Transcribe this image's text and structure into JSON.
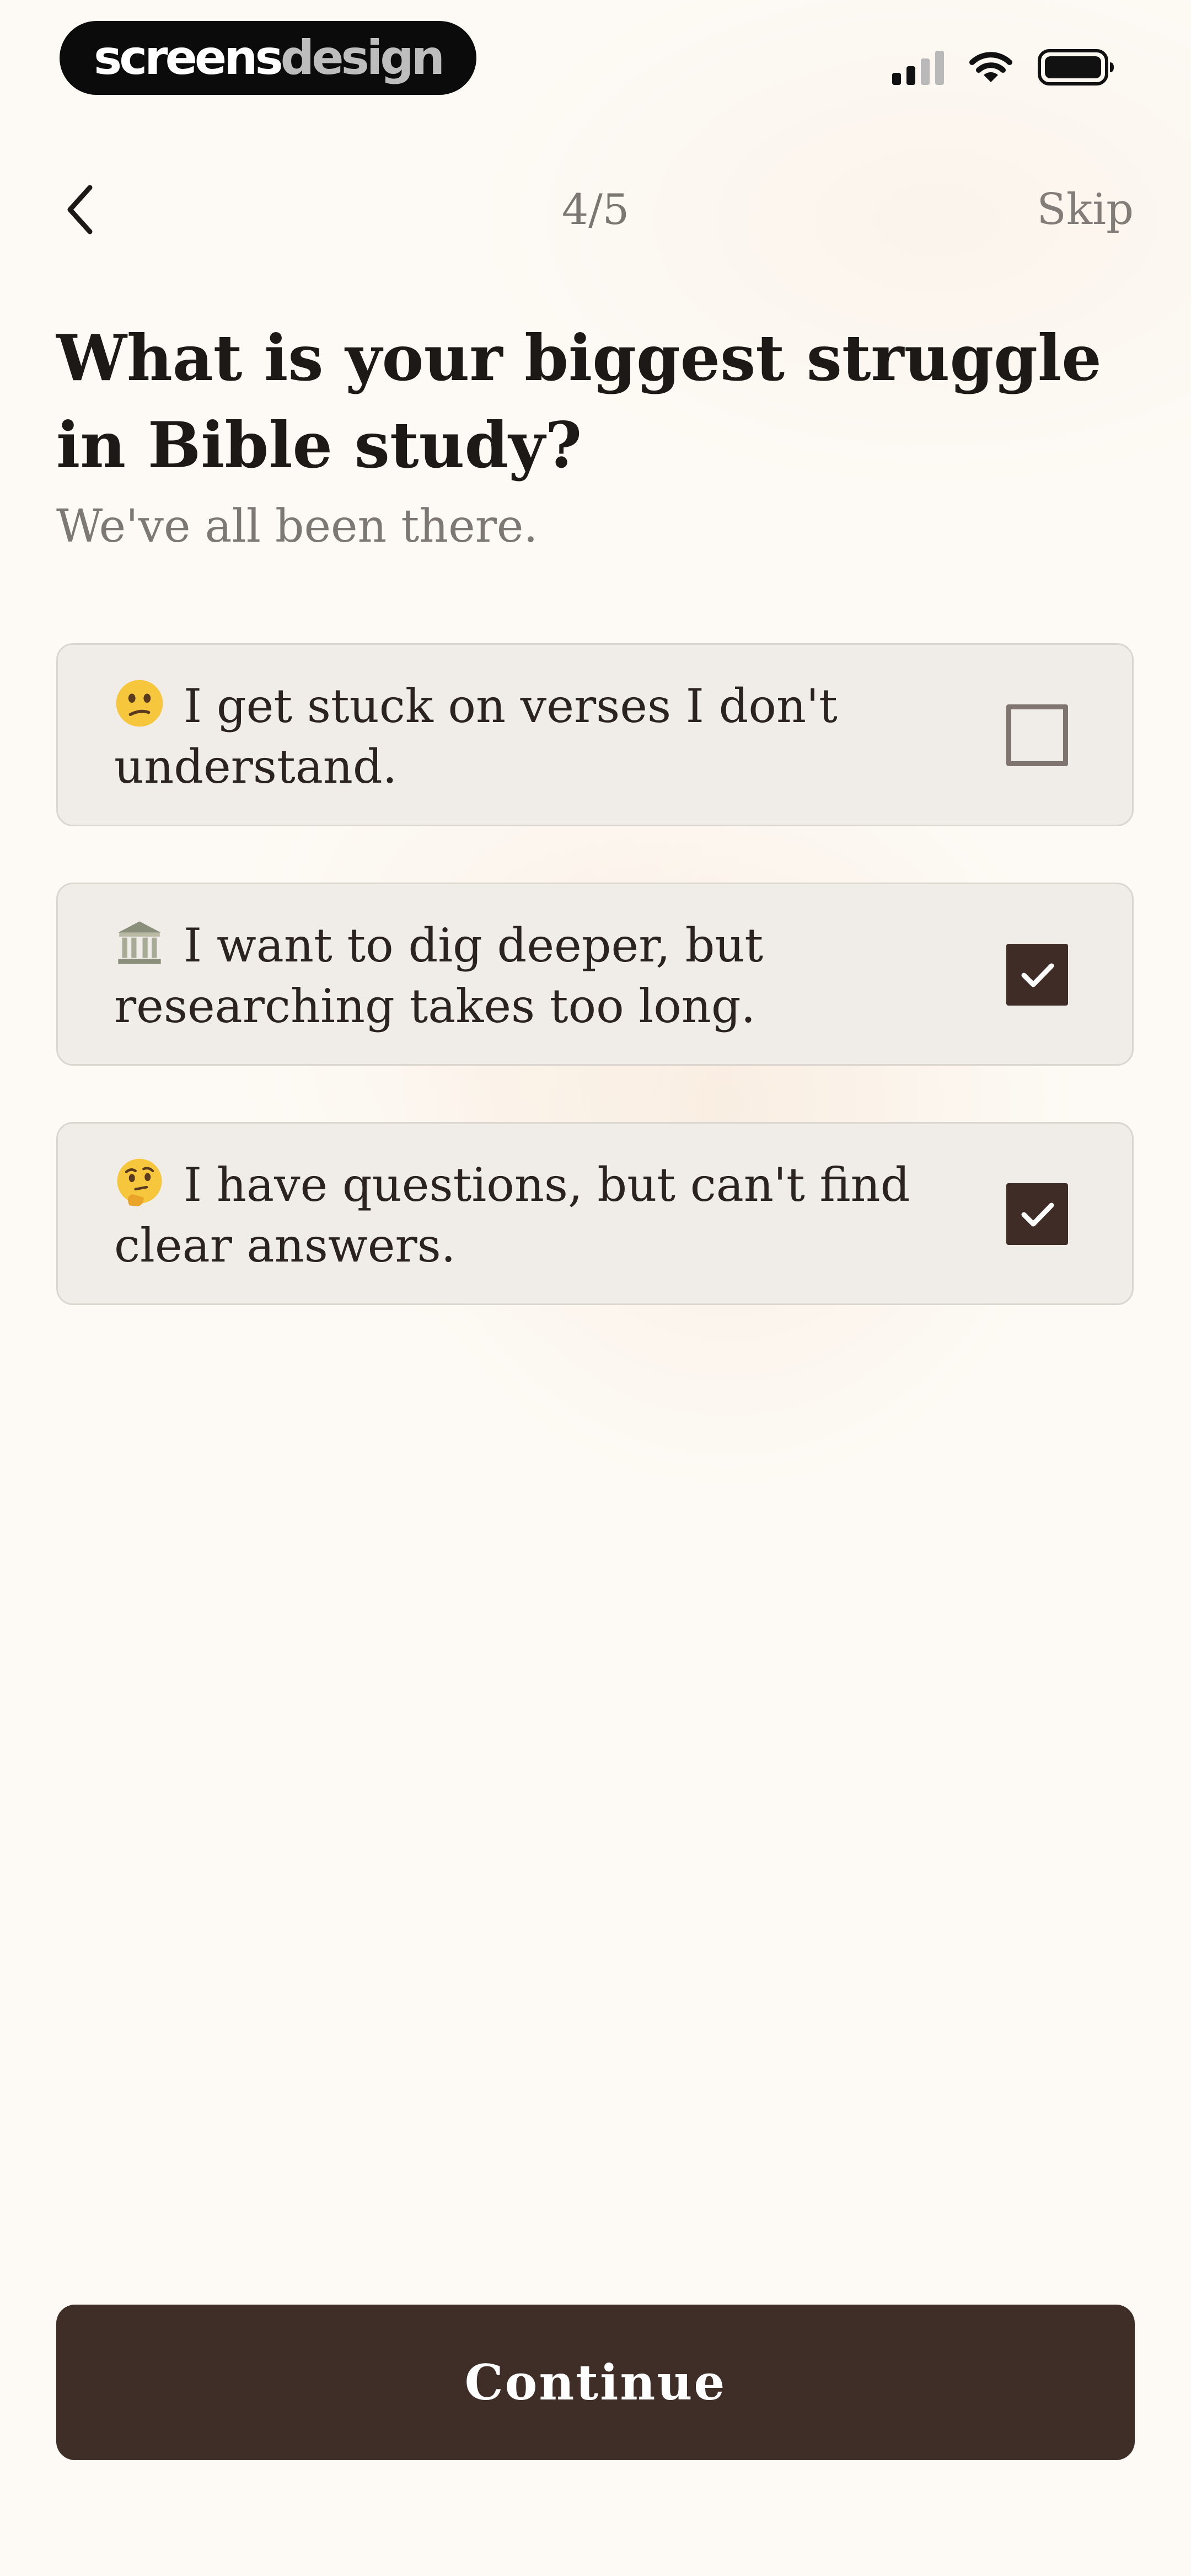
{
  "status_bar": {
    "logo_part1": "screens",
    "logo_part2": "design"
  },
  "nav": {
    "back_icon": "chevron-left-icon",
    "progress": "4/5",
    "skip_label": "Skip"
  },
  "question": {
    "title": "What is your biggest struggle in Bible study?",
    "subtitle": "We've all been there."
  },
  "options": [
    {
      "emoji": "confused-face-icon",
      "text": "I get stuck on verses I don't understand.",
      "checked": false
    },
    {
      "emoji": "classical-building-icon",
      "text": "I want to dig deeper, but researching takes too long.",
      "checked": true
    },
    {
      "emoji": "thinking-face-icon",
      "text": "I have questions, but can't find clear answers.",
      "checked": true
    }
  ],
  "continue_label": "Continue",
  "colors": {
    "background": "#fdfaf5",
    "card": "#f0ece8",
    "accent": "#3f2d28",
    "text": "#1d1917",
    "muted": "#7e7874"
  }
}
